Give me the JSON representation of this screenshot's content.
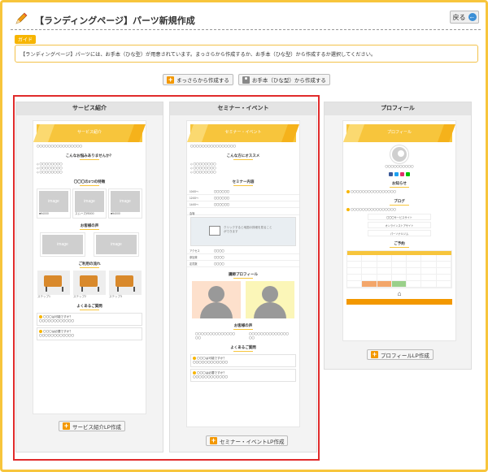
{
  "header": {
    "title": "【ランディングページ】パーツ新規作成",
    "back_label": "戻る"
  },
  "guide": {
    "tag": "ガイド",
    "text": "【ランディングページ】パーツには、お手本（ひな型）が用意されています。まっさらから作成するか、お手本（ひな型）から作成するか選択してください。"
  },
  "actions": {
    "blank_label": "まっさらから作成する",
    "template_label": "お手本（ひな型）から作成する"
  },
  "columns": [
    {
      "title": "サービス紹介",
      "create_label": "サービス紹介LP作成",
      "banner": "サービス紹介",
      "sections": [
        "こんなお悩みありませんか？",
        "〇〇〇の3つの特徴",
        "お客様の声",
        "ご利用の流れ",
        "よくあるご質問"
      ],
      "image_label": "image",
      "prices": [
        "■¥4000",
        "スムーズ¥5000",
        "■¥4000"
      ],
      "steps": [
        "ステップ1",
        "ステップ2",
        "ステップ3"
      ],
      "faq": [
        "〇〇〇は可能ですか？",
        "〇〇〇は必要ですか？"
      ]
    },
    {
      "title": "セミナー・イベント",
      "create_label": "セミナー・イベントLP作成",
      "banner": "セミナー・イベント",
      "sections": [
        "こんな方にオススメ",
        "セミナー内容",
        "講師プロフィール",
        "お客様の声",
        "よくあるご質問"
      ],
      "schedule": [
        "10:00〜",
        "12:00〜",
        "14:00〜"
      ],
      "info_keys": [
        "会場",
        "アクセス",
        "参加費",
        "定員数"
      ],
      "map_text": "クリックすると地図の詳細を見ることができます",
      "faq": [
        "〇〇〇は可能ですか？",
        "〇〇〇は必要ですか？"
      ]
    },
    {
      "title": "プロフィール",
      "create_label": "プロフィールLP作成",
      "banner": "プロフィール",
      "sections": [
        "お知らせ",
        "ブログ",
        "ご予約"
      ],
      "links": [
        "〇〇〇サービスサイト",
        "オンラインストアサイト",
        "パーソナルジム"
      ]
    }
  ]
}
